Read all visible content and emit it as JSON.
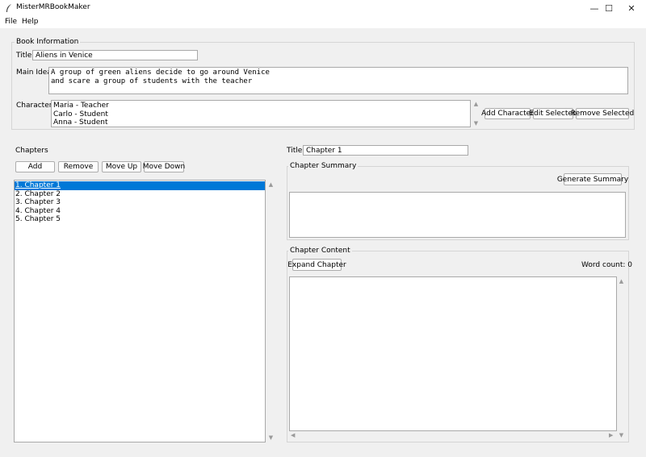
{
  "window": {
    "title": "MisterMRBookMaker",
    "controls": {
      "minimize": "—",
      "maximize": "☐",
      "close": "✕"
    }
  },
  "menu": {
    "file": "File",
    "help": "Help"
  },
  "book_info": {
    "group_label": "Book Information",
    "title_label": "Title:",
    "title_value": "Aliens in Venice",
    "main_idea_label": "Main Idea:",
    "main_idea_value": "A group of green aliens decide to go around Venice\nand scare a group of students with the teacher",
    "characters_label": "Characters:",
    "characters": [
      "Maria - Teacher",
      "Carlo - Student",
      "Anna - Student"
    ],
    "add_character": "Add Character",
    "edit_selected": "Edit Selected",
    "remove_selected": "Remove Selected"
  },
  "chapters": {
    "label": "Chapters",
    "add": "Add",
    "remove": "Remove",
    "move_up": "Move Up",
    "move_down": "Move Down",
    "items": [
      "1. Chapter 1",
      "2. Chapter 2",
      "3. Chapter 3",
      "4. Chapter 4",
      "5. Chapter 5"
    ],
    "selected_index": 0
  },
  "chapter_editor": {
    "title_label": "Title:",
    "title_value": "Chapter 1",
    "summary_label": "Chapter Summary",
    "generate_summary": "Generate Summary",
    "summary_value": "",
    "content_label": "Chapter Content",
    "expand_chapter": "Expand Chapter",
    "word_count": "Word count: 0",
    "content_value": ""
  },
  "icons": {
    "app": "feather-icon",
    "scroll_up": "▲",
    "scroll_down": "▼",
    "scroll_left": "◀",
    "scroll_right": "▶"
  },
  "colors": {
    "selection": "#0078d7",
    "window_bg": "#f0f0f0"
  }
}
